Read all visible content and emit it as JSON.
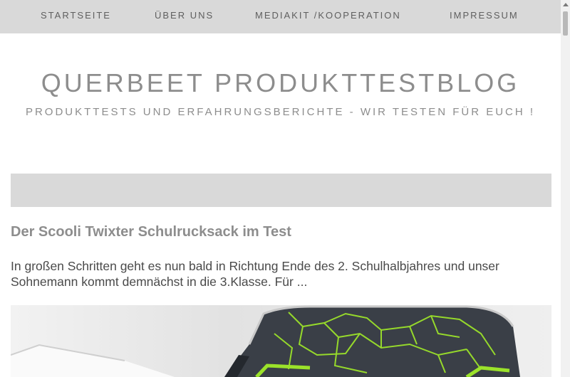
{
  "nav": {
    "items": [
      {
        "label": "STARTSEITE"
      },
      {
        "label": "ÜBER UNS"
      },
      {
        "label": "MEDIAKIT /KOOPERATION"
      },
      {
        "label": "IMPRESSUM"
      }
    ]
  },
  "header": {
    "title": "QUERBEET PRODUKTTESTBLOG",
    "tagline": "PRODUKTTESTS UND ERFAHRUNGSBERICHTE - WIR TESTEN FÜR EUCH !"
  },
  "post": {
    "title": "Der Scooli Twixter Schulrucksack im Test",
    "excerpt": "In großen Schritten geht es nun bald in Richtung Ende des 2. Schulhalbjahres und unser Sohnemann kommt demnächst in die 3.Klasse. Für ..."
  },
  "colors": {
    "nav_bg": "#d9d9d9",
    "title_grey": "#8d8d8d",
    "backpack_green": "#9be22a"
  }
}
